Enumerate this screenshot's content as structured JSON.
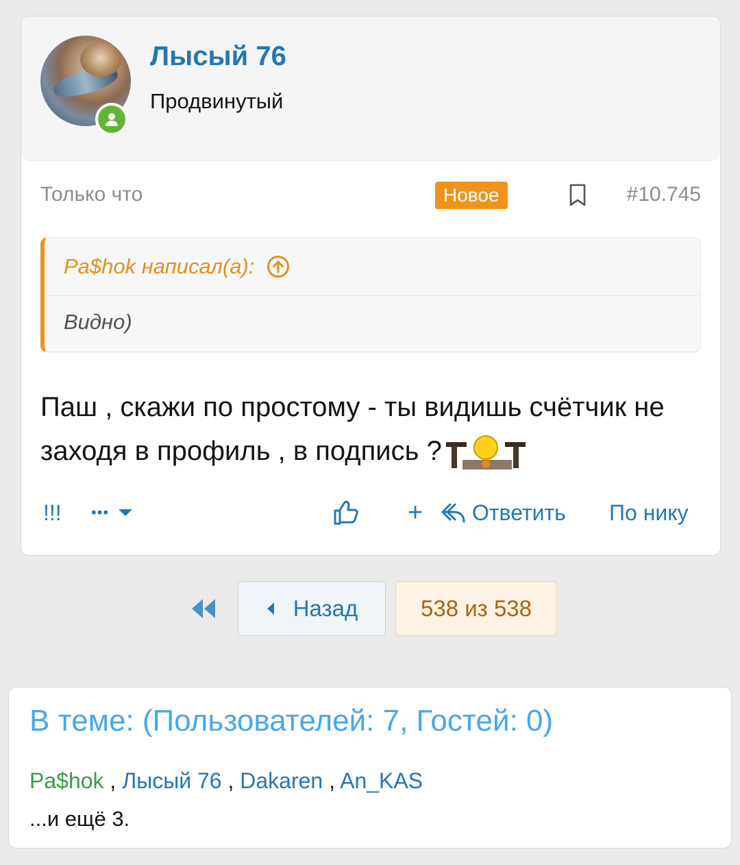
{
  "post": {
    "author": "Лысый 76",
    "user_title": "Продвинутый",
    "time": "Только что",
    "new_badge": "Новое",
    "post_number": "#10.745",
    "quote": {
      "header": "Pa$hok написал(а):",
      "text": "Видно)"
    },
    "message": "Паш , скажи по простому - ты видишь счётчик не заходя в профиль , в подпись ?",
    "actions": {
      "report": "!!!",
      "more": "•••",
      "plus": "+",
      "reply": "Ответить",
      "by_nick": "По нику"
    }
  },
  "pager": {
    "back": "Назад",
    "current": "538 из 538"
  },
  "online": {
    "title": "В теме: (Пользователей: 7, Гостей: 0)",
    "users": [
      "Pa$hok",
      "Лысый 76",
      "Dakaren",
      "An_KAS"
    ],
    "separator": " , ",
    "more": "...и ещё 3."
  },
  "colors": {
    "link": "#2577b1",
    "accent": "#f0931b",
    "online": "#63b337"
  },
  "icons": [
    "user-online-icon",
    "bookmark-icon",
    "arrow-up-circle-icon",
    "thumbs-up-icon",
    "reply-icon",
    "chevron-down-icon",
    "double-chevron-left-icon",
    "chevron-left-icon"
  ]
}
